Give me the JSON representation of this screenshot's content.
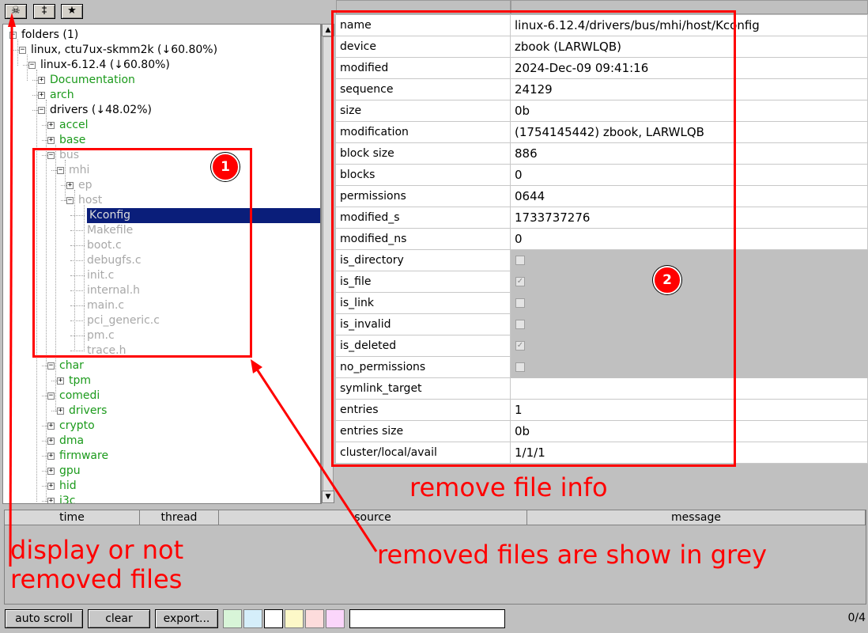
{
  "toolbar": {
    "buttons": [
      "☠",
      "‡",
      "★"
    ]
  },
  "tree": [
    {
      "label": "folders (1)",
      "expander": "−",
      "color": "black"
    },
    {
      "label": "linux, ctu7ux-skmm2k (↓60.80%)",
      "expander": "−",
      "color": "black"
    },
    {
      "label": "linux-6.12.4 (↓60.80%)",
      "expander": "−",
      "color": "black"
    },
    {
      "label": "Documentation",
      "expander": "+",
      "color": "green"
    },
    {
      "label": "arch",
      "expander": "+",
      "color": "green"
    },
    {
      "label": "drivers (↓48.02%)",
      "expander": "−",
      "color": "black"
    },
    {
      "label": "accel",
      "expander": "+",
      "color": "green"
    },
    {
      "label": "base",
      "expander": "+",
      "color": "green"
    },
    {
      "label": "bus",
      "expander": "−",
      "color": "grey"
    },
    {
      "label": "mhi",
      "expander": "−",
      "color": "grey"
    },
    {
      "label": "ep",
      "expander": "+",
      "color": "grey"
    },
    {
      "label": "host",
      "expander": "−",
      "color": "grey"
    },
    {
      "label": "Kconfig",
      "expander": "",
      "color": "grey",
      "selected": true
    },
    {
      "label": "Makefile",
      "expander": "",
      "color": "grey"
    },
    {
      "label": "boot.c",
      "expander": "",
      "color": "grey"
    },
    {
      "label": "debugfs.c",
      "expander": "",
      "color": "grey"
    },
    {
      "label": "init.c",
      "expander": "",
      "color": "grey"
    },
    {
      "label": "internal.h",
      "expander": "",
      "color": "grey"
    },
    {
      "label": "main.c",
      "expander": "",
      "color": "grey"
    },
    {
      "label": "pci_generic.c",
      "expander": "",
      "color": "grey"
    },
    {
      "label": "pm.c",
      "expander": "",
      "color": "grey"
    },
    {
      "label": "trace.h",
      "expander": "",
      "color": "grey"
    },
    {
      "label": "char",
      "expander": "−",
      "color": "green"
    },
    {
      "label": "tpm",
      "expander": "+",
      "color": "green"
    },
    {
      "label": "comedi",
      "expander": "−",
      "color": "green"
    },
    {
      "label": "drivers",
      "expander": "+",
      "color": "green"
    },
    {
      "label": "crypto",
      "expander": "+",
      "color": "green"
    },
    {
      "label": "dma",
      "expander": "+",
      "color": "green"
    },
    {
      "label": "firmware",
      "expander": "+",
      "color": "green"
    },
    {
      "label": "gpu",
      "expander": "+",
      "color": "green"
    },
    {
      "label": "hid",
      "expander": "+",
      "color": "green"
    },
    {
      "label": "i3c",
      "expander": "+",
      "color": "green"
    }
  ],
  "properties": [
    {
      "key": "name",
      "value": "linux-6.12.4/drivers/bus/mhi/host/Kconfig"
    },
    {
      "key": "device",
      "value": "zbook (LARWLQB)"
    },
    {
      "key": "modified",
      "value": "2024-Dec-09 09:41:16"
    },
    {
      "key": "sequence",
      "value": "24129"
    },
    {
      "key": "size",
      "value": "0b"
    },
    {
      "key": "modification",
      "value": "(1754145442) zbook, LARWLQB"
    },
    {
      "key": "block size",
      "value": "886"
    },
    {
      "key": "blocks",
      "value": "0"
    },
    {
      "key": "permissions",
      "value": "0644"
    },
    {
      "key": "modified_s",
      "value": "1733737276"
    },
    {
      "key": "modified_ns",
      "value": "0"
    },
    {
      "key": "is_directory",
      "checkbox": false
    },
    {
      "key": "is_file",
      "checkbox": true
    },
    {
      "key": "is_link",
      "checkbox": false
    },
    {
      "key": "is_invalid",
      "checkbox": false
    },
    {
      "key": "is_deleted",
      "checkbox": true
    },
    {
      "key": "no_permissions",
      "checkbox": false
    },
    {
      "key": "symlink_target",
      "value": ""
    },
    {
      "key": "entries",
      "value": "1"
    },
    {
      "key": "entries size",
      "value": "0b"
    },
    {
      "key": "cluster/local/avail",
      "value": "1/1/1"
    }
  ],
  "log": {
    "columns": [
      "time",
      "thread",
      "source",
      "message"
    ]
  },
  "bottom_bar": {
    "auto_scroll": "auto scroll",
    "clear": "clear",
    "export": "export...",
    "swatches": [
      "#d8f5d8",
      "#d5eefa",
      "#ffffff",
      "#fdf8c8",
      "#fddcdc",
      "#fbd6fb"
    ],
    "filter_value": "",
    "count": "0/4"
  },
  "annotations": {
    "marker1": "1",
    "marker2": "2",
    "remove_file_info": "remove file info",
    "grey_files": "removed files are show in grey",
    "display_removed_line1": "display or not",
    "display_removed_line2": "removed files"
  },
  "colors": {
    "annotation": "#ff0000",
    "selection": "#0a1e7a",
    "green_text": "#1b9a1b",
    "grey_text": "#a8a8a8"
  }
}
